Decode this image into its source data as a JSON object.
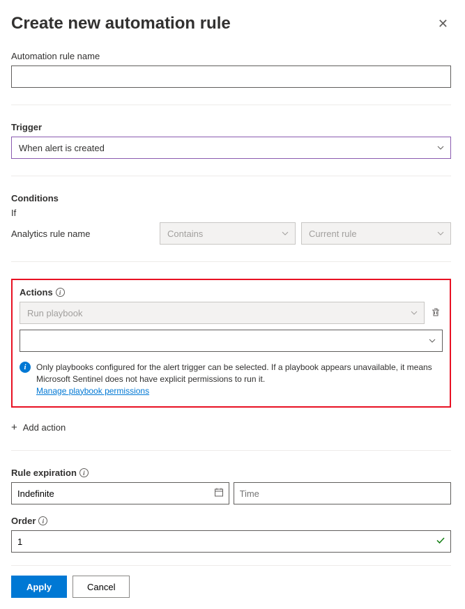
{
  "header": {
    "title": "Create new automation rule"
  },
  "name_section": {
    "label": "Automation rule name",
    "value": ""
  },
  "trigger": {
    "label": "Trigger",
    "selected": "When alert is created"
  },
  "conditions": {
    "label": "Conditions",
    "if_label": "If",
    "rule_name_label": "Analytics rule name",
    "operator": "Contains",
    "value": "Current rule"
  },
  "actions": {
    "label": "Actions",
    "run_playbook": "Run playbook",
    "playbook_selected": "",
    "info_text": "Only playbooks configured for the alert trigger can be selected. If a playbook appears unavailable, it means Microsoft Sentinel does not have explicit permissions to run it.",
    "manage_link": "Manage playbook permissions",
    "add_action": "Add action"
  },
  "expiration": {
    "label": "Rule expiration",
    "date": "Indefinite",
    "time": "Time"
  },
  "order": {
    "label": "Order",
    "value": "1"
  },
  "footer": {
    "apply": "Apply",
    "cancel": "Cancel"
  }
}
